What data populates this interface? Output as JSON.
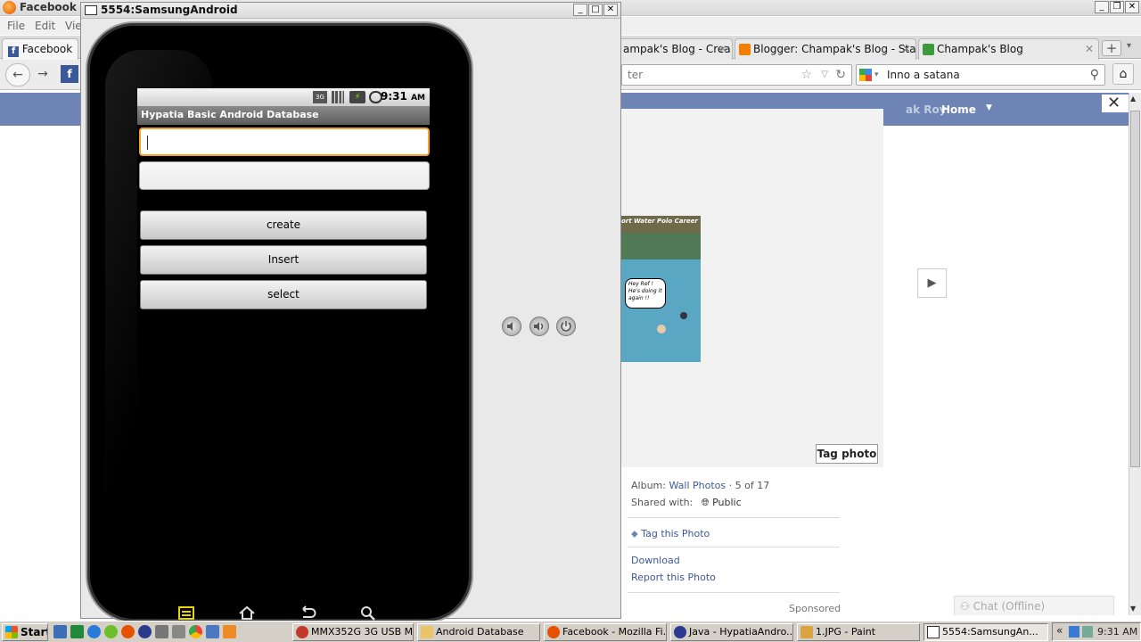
{
  "firefox": {
    "title": "Facebook - M",
    "menu": [
      "File",
      "Edit",
      "View"
    ],
    "tabs": [
      {
        "label": "Facebook"
      },
      {
        "label": "ampak's Blog - Crea..."
      },
      {
        "label": "Blogger: Champak's Blog - Stats"
      },
      {
        "label": "Champak's Blog"
      }
    ],
    "address_partial": "ter",
    "search_value": "Inno a satana"
  },
  "facebook": {
    "nav_links": [
      "ak Roy",
      "Home"
    ],
    "photo_caption": "ort Water Polo Career",
    "comic_bubble": "Hey Ref ! He's doing it again !!",
    "tag_photo_button": "Tag photo",
    "album_label": "Album:",
    "album_name": "Wall Photos",
    "album_count": " · 5 of 17",
    "shared_label": "Shared with:",
    "shared_value": "Public",
    "tag_this_photo": "Tag this Photo",
    "download": "Download",
    "report": "Report this Photo",
    "sponsored": "Sponsored",
    "chat": "Chat (Offline)"
  },
  "emulator": {
    "window_title": "5554:SamsungAndroid",
    "status_time": "9:31",
    "status_ampm": "AM",
    "app_title": "Hypatia Basic Android Database",
    "edit1_value": "",
    "edit2_value": "",
    "buttons": {
      "create": "create",
      "insert": "Insert",
      "select": "select"
    },
    "colors": {
      "focus": "#f7a12b",
      "nav_menu": "#e7d600"
    }
  },
  "taskbar": {
    "start": "Start",
    "items": [
      {
        "label": "MMX352G 3G USB M..."
      },
      {
        "label": "Android Database"
      },
      {
        "label": "Facebook - Mozilla Fi..."
      },
      {
        "label": "Java - HypatiaAndro..."
      },
      {
        "label": "1.JPG - Paint"
      },
      {
        "label": "5554:SamsungAn..."
      }
    ],
    "clock": "9:31 AM",
    "tray_expand": "«"
  }
}
